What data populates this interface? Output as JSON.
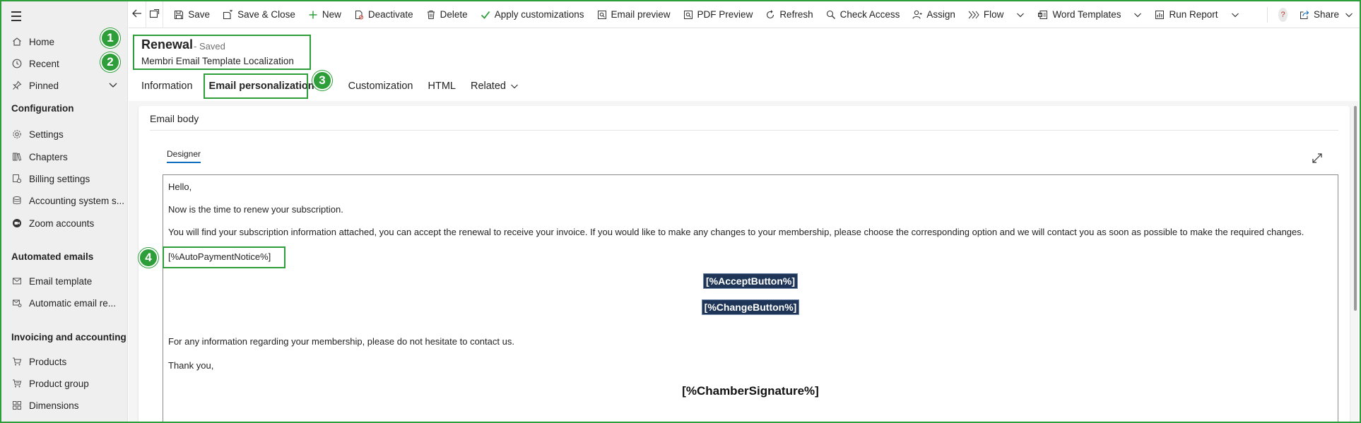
{
  "sidebar": {
    "top_items": [
      {
        "label": "Home",
        "icon": "home-icon"
      },
      {
        "label": "Recent",
        "icon": "clock-icon"
      },
      {
        "label": "Pinned",
        "icon": "pin-icon"
      }
    ],
    "sections": [
      {
        "heading": "Configuration",
        "items": [
          {
            "label": "Settings",
            "icon": "gear-icon"
          },
          {
            "label": "Chapters",
            "icon": "books-icon"
          },
          {
            "label": "Billing settings",
            "icon": "billing-gear-icon"
          },
          {
            "label": "Accounting system s...",
            "icon": "accounting-icon"
          },
          {
            "label": "Zoom accounts",
            "icon": "zoom-icon"
          }
        ]
      },
      {
        "heading": "Automated emails",
        "items": [
          {
            "label": "Email template",
            "icon": "email-template-icon"
          },
          {
            "label": "Automatic email re...",
            "icon": "automatic-email-icon"
          }
        ]
      },
      {
        "heading": "Invoicing and accounting",
        "items": [
          {
            "label": "Products",
            "icon": "cart-icon"
          },
          {
            "label": "Product group",
            "icon": "cart-group-icon"
          },
          {
            "label": "Dimensions",
            "icon": "dimensions-icon"
          }
        ]
      }
    ]
  },
  "toolbar": {
    "save": "Save",
    "save_close": "Save & Close",
    "new": "New",
    "deactivate": "Deactivate",
    "delete": "Delete",
    "apply_customizations": "Apply customizations",
    "email_preview": "Email preview",
    "pdf_preview": "PDF Preview",
    "refresh": "Refresh",
    "check_access": "Check Access",
    "assign": "Assign",
    "flow": "Flow",
    "word_templates": "Word Templates",
    "run_report": "Run Report",
    "help": "?",
    "share": "Share"
  },
  "header": {
    "title": "Renewal",
    "status": "- Saved",
    "subtitle": "Membri Email Template Localization"
  },
  "tabs": [
    "Information",
    "Email personalization",
    "Customization",
    "HTML",
    "Related"
  ],
  "badges": [
    "1",
    "2",
    "3",
    "4"
  ],
  "section": {
    "title": "Email body",
    "designer_tab": "Designer"
  },
  "email": {
    "greeting": "Hello,",
    "line1": "Now is the time to renew your subscription.",
    "line2": "You will find your subscription information attached, you can accept the renewal to receive your invoice. If you would like to make any changes to your membership, please choose the corresponding option and we will contact you as soon as possible to make the required changes.",
    "auto_payment": "[%AutoPaymentNotice%]",
    "accept_button": "[%AcceptButton%]",
    "change_button": "[%ChangeButton%]",
    "info_line": "For any information regarding your membership, please do not hesitate to contact us.",
    "thanks": "Thank you,",
    "signature": "[%ChamberSignature%]"
  },
  "colors": {
    "highlight_green": "#2e9e3a",
    "placeholder_navy": "#1e3557",
    "tab_underline": "#0f6cbd"
  }
}
